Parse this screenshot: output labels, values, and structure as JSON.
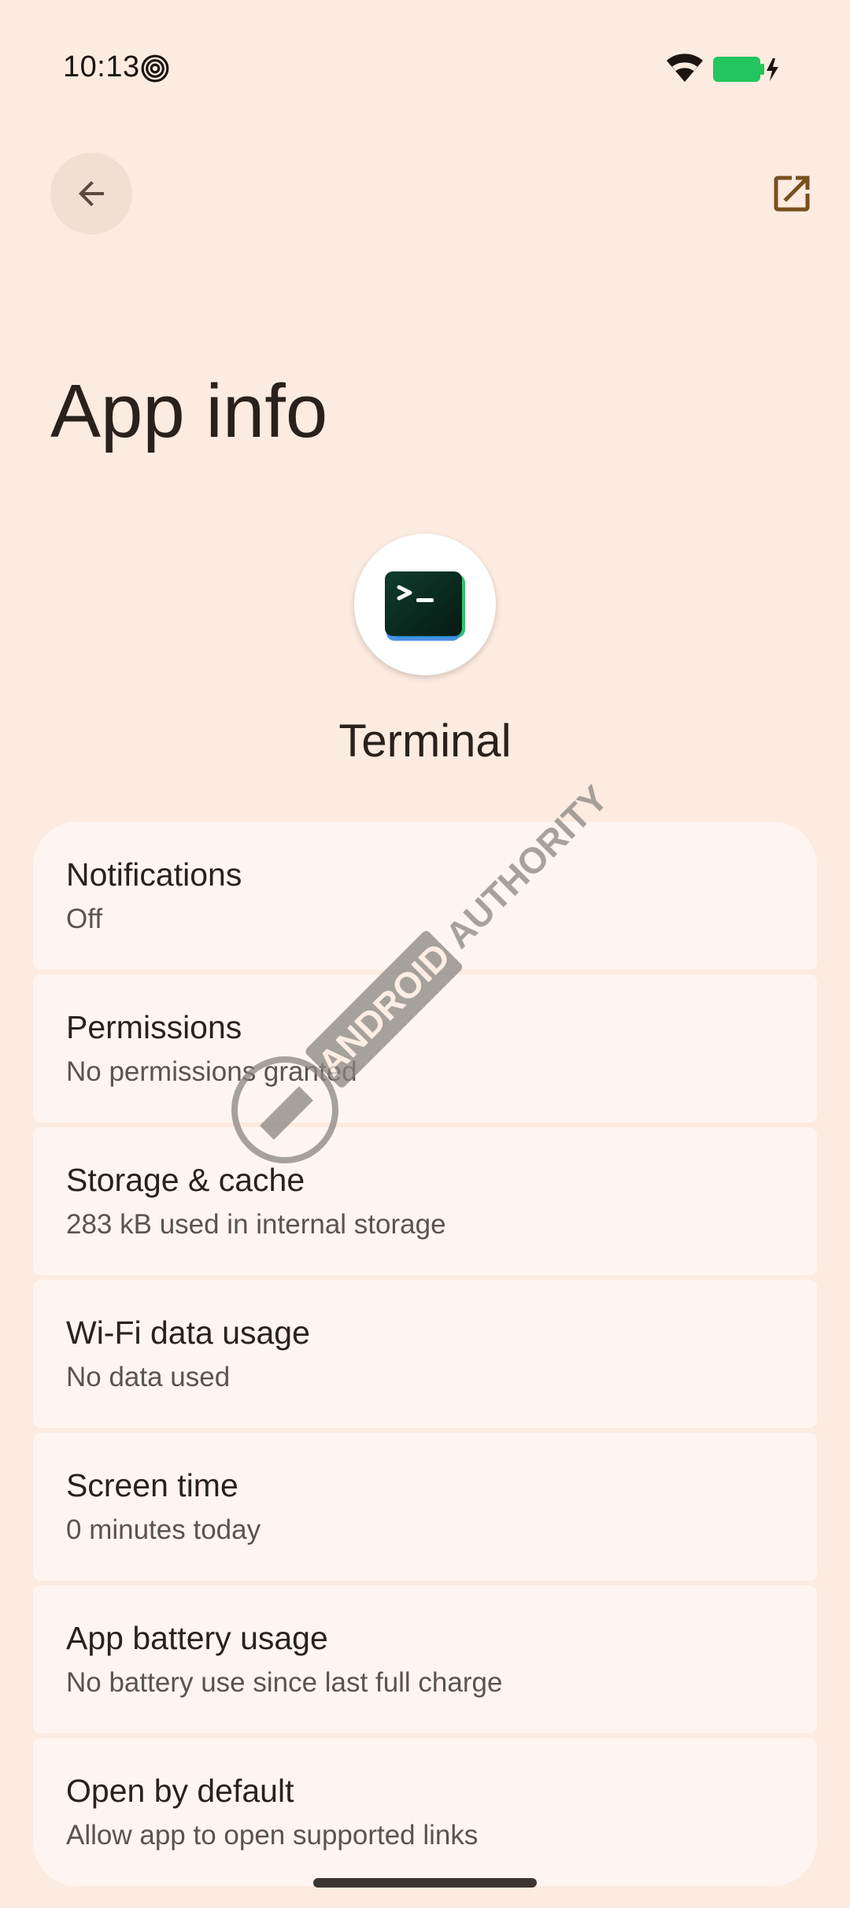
{
  "status_bar": {
    "time": "10:13",
    "notification_icon": "spiral-notification-icon",
    "wifi_icon": "wifi-icon",
    "battery_icon": "battery-charging-icon",
    "battery_color": "#22c55e"
  },
  "toolbar": {
    "back_icon": "arrow-back-icon",
    "open_icon": "open-in-new-icon",
    "accent": "#7a4f1f"
  },
  "page": {
    "title": "App info"
  },
  "app": {
    "name": "Terminal",
    "icon": "terminal-icon"
  },
  "settings": [
    {
      "title": "Notifications",
      "subtitle": "Off"
    },
    {
      "title": "Permissions",
      "subtitle": "No permissions granted"
    },
    {
      "title": "Storage & cache",
      "subtitle": "283 kB used in internal storage"
    },
    {
      "title": "Wi-Fi data usage",
      "subtitle": "No data used"
    },
    {
      "title": "Screen time",
      "subtitle": "0 minutes today"
    },
    {
      "title": "App battery usage",
      "subtitle": "No battery use since last full charge"
    },
    {
      "title": "Open by default",
      "subtitle": "Allow app to open supported links"
    }
  ],
  "watermark": {
    "text": "ANDROID AUTHORITY"
  },
  "colors": {
    "background": "#fcebe0",
    "card": "#fff5f0"
  }
}
